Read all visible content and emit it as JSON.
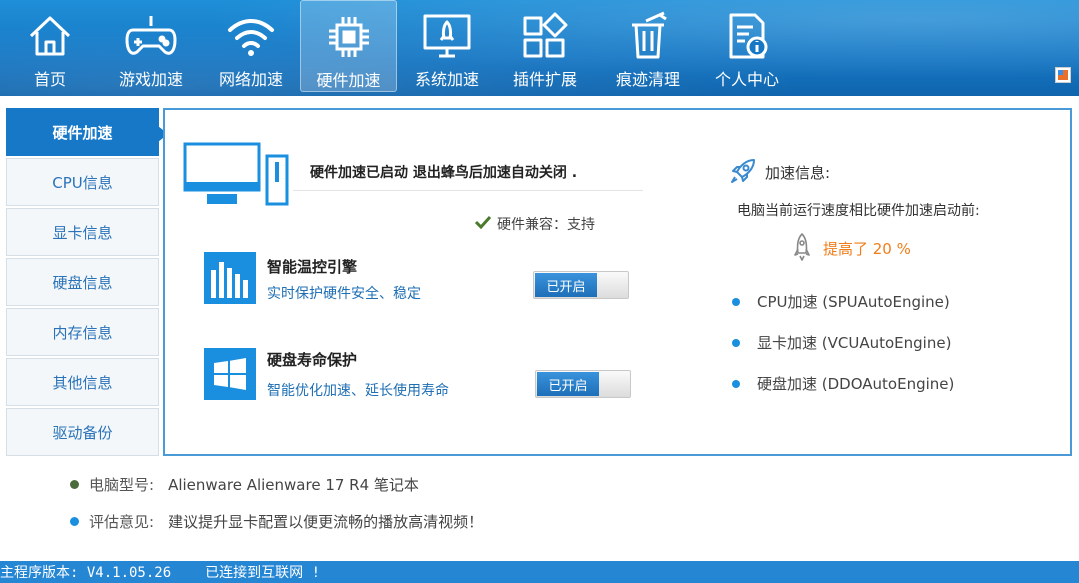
{
  "nav": {
    "items": [
      {
        "label": "首页",
        "icon": "home-icon"
      },
      {
        "label": "游戏加速",
        "icon": "gamepad-icon"
      },
      {
        "label": "网络加速",
        "icon": "wifi-icon"
      },
      {
        "label": "硬件加速",
        "icon": "chip-icon"
      },
      {
        "label": "系统加速",
        "icon": "monitor-rocket-icon"
      },
      {
        "label": "插件扩展",
        "icon": "plugin-grid-icon"
      },
      {
        "label": "痕迹清理",
        "icon": "trash-icon"
      },
      {
        "label": "个人中心",
        "icon": "document-info-icon"
      }
    ],
    "active": "硬件加速"
  },
  "sidebar": {
    "items": [
      {
        "label": "硬件加速"
      },
      {
        "label": "CPU信息"
      },
      {
        "label": "显卡信息"
      },
      {
        "label": "硬盘信息"
      },
      {
        "label": "内存信息"
      },
      {
        "label": "其他信息"
      },
      {
        "label": "驱动备份"
      }
    ],
    "active": "硬件加速"
  },
  "main": {
    "status": "硬件加速已启动 退出蜂鸟后加速自动关闭 .",
    "compat": "硬件兼容：支持",
    "features": [
      {
        "title": "智能温控引擎",
        "desc": "实时保护硬件安全、稳定",
        "toggle": "已开启"
      },
      {
        "title": "硬盘寿命保护",
        "desc": "智能优化加速、延长使用寿命",
        "toggle": "已开启"
      }
    ],
    "info": {
      "title": "加速信息:",
      "subtitle": "电脑当前运行速度相比硬件加速启动前:",
      "improvement": "提高了 20 %",
      "engines": [
        "CPU加速 (SPUAutoEngine)",
        "显卡加速 (VCUAutoEngine)",
        "硬盘加速 (DDOAutoEngine)"
      ]
    }
  },
  "bottom": {
    "model_key": "电脑型号:",
    "model_value": "Alienware Alienware 17 R4 笔记本",
    "advice_key": "评估意见:",
    "advice_value": "建议提升显卡配置以便更流畅的播放高清视频！"
  },
  "statusbar": {
    "version": "主程序版本: V4.1.05.26",
    "connection": "已连接到互联网 !"
  },
  "colors": {
    "nav_bg": "#1677c4",
    "accent": "#1878c8",
    "orange": "#f07d1a",
    "status_bar": "#2586d4"
  }
}
